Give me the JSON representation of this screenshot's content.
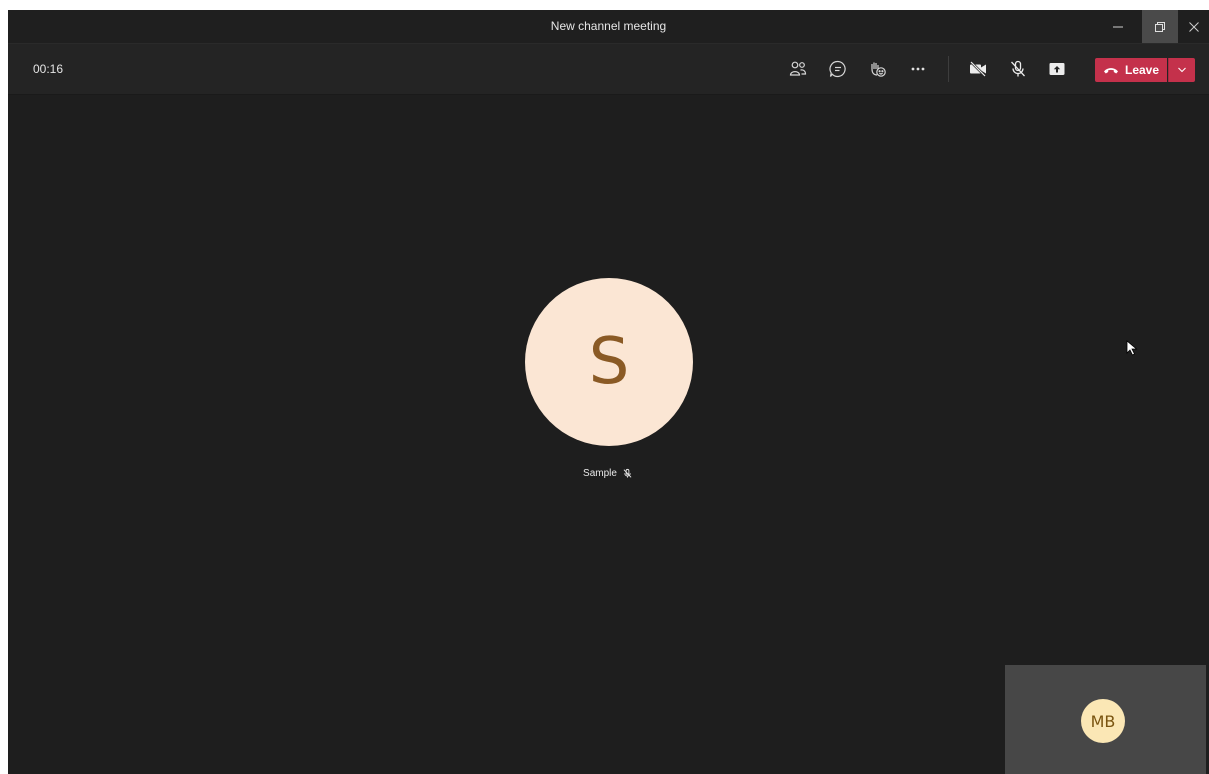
{
  "window": {
    "title": "New channel meeting"
  },
  "toolbar": {
    "timer": "00:16",
    "buttons": [
      {
        "icon": "participants-icon"
      },
      {
        "icon": "chat-icon"
      },
      {
        "icon": "reactions-icon"
      },
      {
        "icon": "more-options-icon"
      },
      {
        "icon": "camera-off-icon"
      },
      {
        "icon": "mic-off-icon"
      },
      {
        "icon": "share-screen-icon"
      }
    ],
    "leave_label": "Leave"
  },
  "stage": {
    "main_participant": {
      "initials": "S",
      "name": "Sample",
      "muted": true
    },
    "self_view": {
      "initials": "MB"
    }
  },
  "colors": {
    "background": "#1e1e1e",
    "leave_button": "#c4314b",
    "main_avatar_bg": "#fbe6d4",
    "main_avatar_text": "#8a5a25",
    "self_avatar_bg": "#fbe7b5",
    "self_tile_bg": "#474747"
  }
}
